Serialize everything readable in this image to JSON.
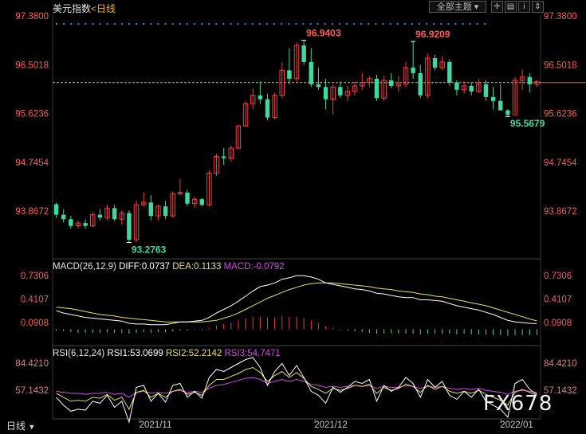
{
  "header": {
    "title": "美元指数",
    "period": "日线",
    "theme_button": "全部主题",
    "tool_icons": [
      "cross-icon",
      "sub-chart-icon",
      "info-icon",
      "scale-icon"
    ]
  },
  "price_axis": {
    "ticks": [
      "97.3800",
      "96.5018",
      "95.6236",
      "94.7454",
      "93.8672"
    ],
    "current_price_line": 96.18
  },
  "macd": {
    "label": "MACD(26,12,9)",
    "diff": "DIFF:0.0737",
    "dea": "DEA:0.1133",
    "macd": "MACD:-0.0792",
    "ticks": [
      "0.7306",
      "0.4107",
      "0.0908"
    ]
  },
  "rsi": {
    "label": "RSI(6,12,24)",
    "rsi1": "RSI1:53.0699",
    "rsi2": "RSI2:52.2142",
    "rsi3": "RSI3:54.7471",
    "ticks": [
      "84.4210",
      "57.1432"
    ]
  },
  "time_axis": [
    "2021/11",
    "2021/12",
    "2022/01"
  ],
  "bottom_tab": "日线",
  "watermark": "FX678",
  "annotations": {
    "high1": "96.9403",
    "high2": "96.9209",
    "low1": "93.2763",
    "low2": "95.5679"
  },
  "colors": {
    "up": "#ff3b3b",
    "down": "#3fd9a0",
    "diff": "#ffffff",
    "dea": "#e8e05a",
    "rsi1": "#ffffff",
    "rsi2": "#e8e05a",
    "rsi3": "#d04be0",
    "axis_text": "#ff5a5a",
    "rsi_axis_text": "#e08080"
  },
  "chart_data": {
    "type": "candlestick",
    "ohlc": [
      [
        93.99,
        94.02,
        93.75,
        93.8
      ],
      [
        93.8,
        93.9,
        93.66,
        93.72
      ],
      [
        93.72,
        93.78,
        93.55,
        93.6
      ],
      [
        93.6,
        93.7,
        93.55,
        93.65
      ],
      [
        93.65,
        93.72,
        93.55,
        93.6
      ],
      [
        93.6,
        93.85,
        93.58,
        93.8
      ],
      [
        93.8,
        93.9,
        93.7,
        93.75
      ],
      [
        93.75,
        93.98,
        93.7,
        93.92
      ],
      [
        93.92,
        93.98,
        93.68,
        93.72
      ],
      [
        93.72,
        93.88,
        93.62,
        93.83
      ],
      [
        93.83,
        93.88,
        93.3,
        93.35
      ],
      [
        93.35,
        94.05,
        93.3,
        93.98
      ],
      [
        93.98,
        94.2,
        93.95,
        94.02
      ],
      [
        94.02,
        94.15,
        93.7,
        93.78
      ],
      [
        93.78,
        93.98,
        93.7,
        93.95
      ],
      [
        93.95,
        94.05,
        93.72,
        93.78
      ],
      [
        93.78,
        94.22,
        93.75,
        94.18
      ],
      [
        94.18,
        94.45,
        94.15,
        94.2
      ],
      [
        94.2,
        94.25,
        93.95,
        94.0
      ],
      [
        94.0,
        94.12,
        93.92,
        94.08
      ],
      [
        94.08,
        94.1,
        93.95,
        93.98
      ],
      [
        93.98,
        94.6,
        93.95,
        94.55
      ],
      [
        94.55,
        94.9,
        94.5,
        94.85
      ],
      [
        94.85,
        95.0,
        94.7,
        94.82
      ],
      [
        94.82,
        95.05,
        94.75,
        95.0
      ],
      [
        95.0,
        95.42,
        94.98,
        95.4
      ],
      [
        95.4,
        95.85,
        95.38,
        95.8
      ],
      [
        95.8,
        96.08,
        95.7,
        95.95
      ],
      [
        95.95,
        96.2,
        95.8,
        95.88
      ],
      [
        95.88,
        95.98,
        95.5,
        95.55
      ],
      [
        95.55,
        96.0,
        95.52,
        95.95
      ],
      [
        95.95,
        96.55,
        95.9,
        96.4
      ],
      [
        96.4,
        96.8,
        96.15,
        96.25
      ],
      [
        96.25,
        96.9,
        96.2,
        96.85
      ],
      [
        96.85,
        96.94,
        96.5,
        96.55
      ],
      [
        96.55,
        96.8,
        96.1,
        96.15
      ],
      [
        96.15,
        96.45,
        96.05,
        96.1
      ],
      [
        96.1,
        96.25,
        95.7,
        95.88
      ],
      [
        95.88,
        96.15,
        95.6,
        96.1
      ],
      [
        96.1,
        96.2,
        95.9,
        95.95
      ],
      [
        95.95,
        96.12,
        95.85,
        96.02
      ],
      [
        96.02,
        96.2,
        95.95,
        96.12
      ],
      [
        96.12,
        96.35,
        96.05,
        96.18
      ],
      [
        96.18,
        96.3,
        96.1,
        96.25
      ],
      [
        96.25,
        96.32,
        95.85,
        95.9
      ],
      [
        95.9,
        96.3,
        95.85,
        96.22
      ],
      [
        96.22,
        96.35,
        96.08,
        96.12
      ],
      [
        96.12,
        96.3,
        96.02,
        96.15
      ],
      [
        96.15,
        96.55,
        96.1,
        96.45
      ],
      [
        96.45,
        96.92,
        96.25,
        96.35
      ],
      [
        96.35,
        96.5,
        95.9,
        95.95
      ],
      [
        95.95,
        96.7,
        95.9,
        96.62
      ],
      [
        96.62,
        96.68,
        96.4,
        96.45
      ],
      [
        96.45,
        96.65,
        96.4,
        96.55
      ],
      [
        96.55,
        96.6,
        96.12,
        96.18
      ],
      [
        96.18,
        96.22,
        95.95,
        96.05
      ],
      [
        96.05,
        96.2,
        95.98,
        96.12
      ],
      [
        96.12,
        96.18,
        95.95,
        96.02
      ],
      [
        96.02,
        96.25,
        96.0,
        96.15
      ],
      [
        96.15,
        96.22,
        95.85,
        95.92
      ],
      [
        95.92,
        96.1,
        95.7,
        95.85
      ],
      [
        95.85,
        96.15,
        95.7,
        95.68
      ],
      [
        95.68,
        95.7,
        95.57,
        95.6
      ],
      [
        95.6,
        96.28,
        95.62,
        96.22
      ],
      [
        96.22,
        96.42,
        96.05,
        96.28
      ],
      [
        96.28,
        96.35,
        96.0,
        96.15
      ],
      [
        96.15,
        96.22,
        96.1,
        96.2
      ]
    ],
    "macd_hist": [
      -0.02,
      -0.03,
      -0.04,
      -0.05,
      -0.05,
      -0.05,
      -0.05,
      -0.04,
      -0.05,
      -0.05,
      -0.06,
      -0.05,
      -0.04,
      -0.05,
      -0.04,
      -0.04,
      -0.03,
      -0.02,
      -0.02,
      -0.01,
      -0.01,
      0.02,
      0.05,
      0.07,
      0.09,
      0.12,
      0.15,
      0.17,
      0.17,
      0.16,
      0.16,
      0.18,
      0.17,
      0.17,
      0.15,
      0.12,
      0.08,
      0.04,
      0.02,
      -0.01,
      -0.02,
      -0.03,
      -0.04,
      -0.05,
      -0.06,
      -0.06,
      -0.06,
      -0.06,
      -0.06,
      -0.06,
      -0.07,
      -0.06,
      -0.06,
      -0.06,
      -0.06,
      -0.07,
      -0.06,
      -0.07,
      -0.07,
      -0.07,
      -0.08,
      -0.08,
      -0.09,
      -0.08,
      -0.08,
      -0.08,
      -0.08
    ],
    "diff": [
      0.25,
      0.22,
      0.2,
      0.18,
      0.16,
      0.15,
      0.14,
      0.13,
      0.12,
      0.11,
      0.08,
      0.07,
      0.07,
      0.06,
      0.06,
      0.06,
      0.08,
      0.1,
      0.1,
      0.11,
      0.12,
      0.16,
      0.22,
      0.27,
      0.32,
      0.38,
      0.45,
      0.52,
      0.58,
      0.6,
      0.63,
      0.68,
      0.7,
      0.73,
      0.73,
      0.71,
      0.68,
      0.63,
      0.61,
      0.59,
      0.57,
      0.55,
      0.54,
      0.52,
      0.49,
      0.48,
      0.46,
      0.44,
      0.43,
      0.43,
      0.4,
      0.4,
      0.39,
      0.38,
      0.35,
      0.32,
      0.3,
      0.28,
      0.26,
      0.23,
      0.2,
      0.16,
      0.12,
      0.1,
      0.09,
      0.08,
      0.074
    ],
    "dea": [
      0.3,
      0.29,
      0.28,
      0.26,
      0.24,
      0.22,
      0.2,
      0.19,
      0.18,
      0.16,
      0.15,
      0.14,
      0.13,
      0.12,
      0.11,
      0.1,
      0.1,
      0.1,
      0.1,
      0.1,
      0.1,
      0.11,
      0.12,
      0.15,
      0.18,
      0.22,
      0.27,
      0.32,
      0.37,
      0.42,
      0.46,
      0.5,
      0.54,
      0.57,
      0.6,
      0.62,
      0.63,
      0.63,
      0.63,
      0.62,
      0.61,
      0.6,
      0.59,
      0.58,
      0.56,
      0.55,
      0.54,
      0.52,
      0.51,
      0.5,
      0.48,
      0.47,
      0.45,
      0.44,
      0.42,
      0.4,
      0.38,
      0.36,
      0.34,
      0.32,
      0.29,
      0.26,
      0.23,
      0.2,
      0.17,
      0.14,
      0.113
    ],
    "rsi1": [
      50,
      42,
      36,
      38,
      37,
      46,
      44,
      52,
      40,
      46,
      25,
      60,
      62,
      46,
      54,
      45,
      62,
      64,
      50,
      56,
      49,
      70,
      78,
      76,
      80,
      84,
      88,
      90,
      80,
      62,
      76,
      84,
      72,
      82,
      70,
      56,
      52,
      44,
      60,
      55,
      60,
      66,
      64,
      68,
      46,
      62,
      56,
      60,
      70,
      64,
      50,
      68,
      60,
      66,
      52,
      48,
      56,
      50,
      58,
      46,
      42,
      38,
      30,
      64,
      68,
      58,
      53
    ],
    "rsi2": [
      54,
      50,
      46,
      47,
      46,
      50,
      49,
      53,
      47,
      50,
      38,
      55,
      57,
      50,
      54,
      50,
      56,
      58,
      53,
      55,
      52,
      62,
      68,
      68,
      71,
      74,
      78,
      80,
      75,
      66,
      72,
      76,
      70,
      75,
      69,
      61,
      58,
      54,
      59,
      57,
      59,
      62,
      61,
      63,
      54,
      60,
      57,
      59,
      63,
      61,
      55,
      62,
      58,
      61,
      56,
      54,
      56,
      54,
      57,
      53,
      50,
      47,
      42,
      55,
      58,
      55,
      52
    ],
    "rsi3": [
      56,
      55,
      54,
      54,
      53,
      54,
      54,
      55,
      53,
      54,
      50,
      55,
      56,
      54,
      55,
      54,
      56,
      57,
      55,
      56,
      55,
      59,
      62,
      63,
      65,
      67,
      69,
      70,
      68,
      64,
      66,
      68,
      66,
      68,
      66,
      63,
      62,
      60,
      61,
      60,
      61,
      62,
      61,
      62,
      59,
      61,
      60,
      60,
      62,
      61,
      59,
      61,
      60,
      61,
      59,
      58,
      59,
      58,
      59,
      57,
      56,
      55,
      53,
      56,
      57,
      56,
      54.7
    ]
  }
}
